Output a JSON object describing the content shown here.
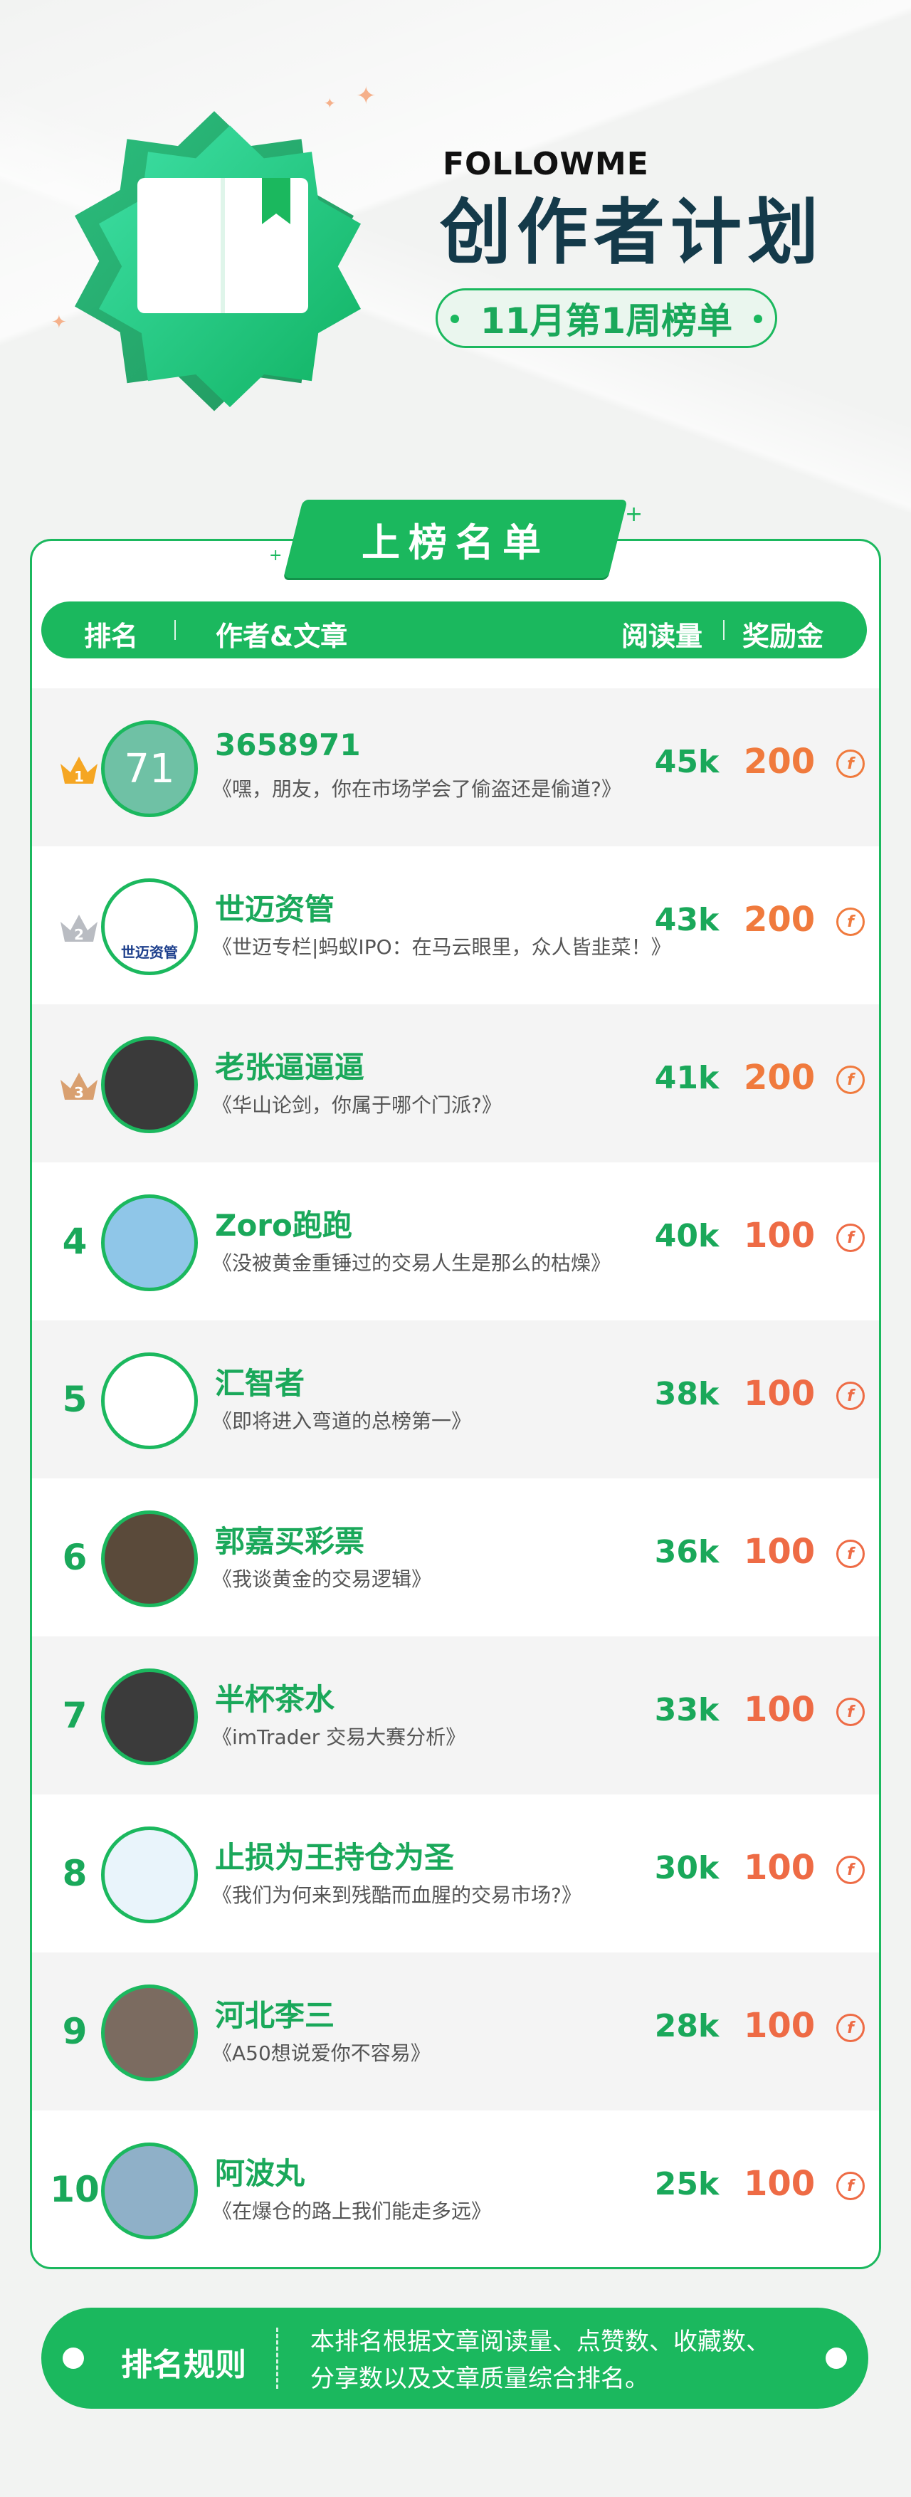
{
  "header": {
    "brand": "FOLLOWME",
    "title": "创作者计划",
    "week": "11月第1周榜单"
  },
  "section_title": "上榜名单",
  "columns": {
    "rank": "排名",
    "author_article": "作者&文章",
    "reads": "阅读量",
    "bonus": "奖励金"
  },
  "colors": {
    "accent": "#1bb85e",
    "top_bonus": "#f07a3d",
    "bonus": "#ee6b45",
    "title": "#143a4a"
  },
  "rows": [
    {
      "rank": "1",
      "author": "3658971",
      "article": "《嘿，朋友，你在市场学会了偷盗还是偷道?》",
      "reads": "45k",
      "bonus": "200",
      "avatar_text": "71",
      "crown": "gold"
    },
    {
      "rank": "2",
      "author": "世迈资管",
      "article": "《世迈专栏|蚂蚁IPO：在马云眼里，众人皆韭菜！》",
      "reads": "43k",
      "bonus": "200",
      "avatar_text": "世迈资管",
      "crown": "silver"
    },
    {
      "rank": "3",
      "author": "老张逼逼逼",
      "article": "《华山论剑，你属于哪个门派?》",
      "reads": "41k",
      "bonus": "200",
      "crown": "bronze"
    },
    {
      "rank": "4",
      "author": "Zoro跑跑",
      "article": "《没被黄金重锤过的交易人生是那么的枯燥》",
      "reads": "40k",
      "bonus": "100"
    },
    {
      "rank": "5",
      "author": "汇智者",
      "article": "《即将进入弯道的总榜第一》",
      "reads": "38k",
      "bonus": "100"
    },
    {
      "rank": "6",
      "author": "郭嘉买彩票",
      "article": "《我谈黄金的交易逻辑》",
      "reads": "36k",
      "bonus": "100"
    },
    {
      "rank": "7",
      "author": "半杯茶水",
      "article": "《imTrader 交易大赛分析》",
      "reads": "33k",
      "bonus": "100"
    },
    {
      "rank": "8",
      "author": "止损为王持仓为圣",
      "article": "《我们为何来到残酷而血腥的交易市场?》",
      "reads": "30k",
      "bonus": "100"
    },
    {
      "rank": "9",
      "author": "河北李三",
      "article": "《A50想说爱你不容易》",
      "reads": "28k",
      "bonus": "100"
    },
    {
      "rank": "10",
      "author": "阿波丸",
      "article": "《在爆仓的路上我们能走多远》",
      "reads": "25k",
      "bonus": "100"
    }
  ],
  "coin_symbol": "f",
  "footer": {
    "title": "排名规则",
    "line1": "本排名根据文章阅读量、点赞数、收藏数、",
    "line2": "分享数以及文章质量综合排名。"
  }
}
